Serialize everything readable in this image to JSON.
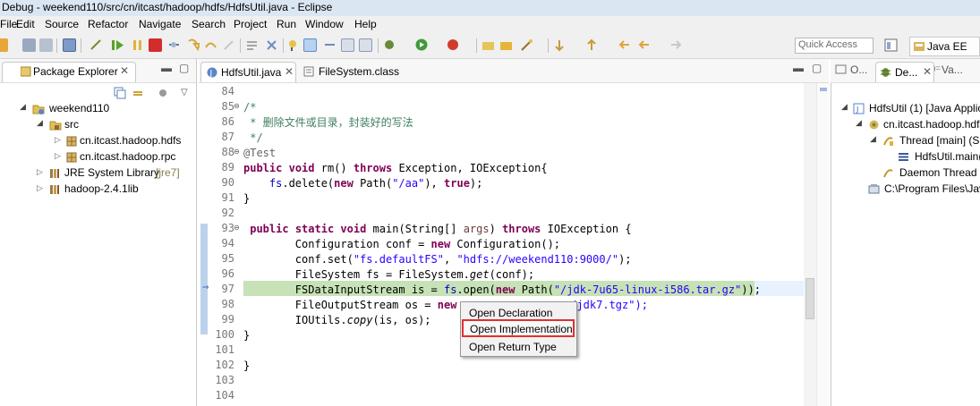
{
  "window": {
    "title": "Debug - weekend110/src/cn/itcast/hadoop/hdfs/HdfsUtil.java - Eclipse"
  },
  "menu": [
    "File",
    "Edit",
    "Source",
    "Refactor",
    "Navigate",
    "Search",
    "Project",
    "Run",
    "Window",
    "Help"
  ],
  "toolbar": {
    "quick_access_placeholder": "Quick Access",
    "perspective": "Java EE"
  },
  "package_explorer": {
    "title": "Package Explorer",
    "tree": [
      {
        "label": "weekend110",
        "icon": "project-icon"
      },
      {
        "label": "src",
        "icon": "source-folder-icon"
      },
      {
        "label": "cn.itcast.hadoop.hdfs",
        "icon": "package-icon"
      },
      {
        "label": "cn.itcast.hadoop.rpc",
        "icon": "package-icon"
      },
      {
        "label": "JRE System Library",
        "suffix": "[jre7]",
        "icon": "library-icon"
      },
      {
        "label": "hadoop-2.4.1lib",
        "icon": "library-icon"
      }
    ]
  },
  "editor": {
    "tabs": [
      {
        "label": "HdfsUtil.java",
        "active": true
      },
      {
        "label": "FileSystem.class",
        "active": false
      }
    ],
    "line_numbers": [
      "84",
      "85",
      "86",
      "87",
      "88",
      "89",
      "90",
      "91",
      "92",
      "93",
      "94",
      "95",
      "96",
      "97",
      "98",
      "99",
      "100",
      "101",
      "102",
      "103",
      "104"
    ],
    "lines": [
      "",
      "/*",
      " * 删除文件或目录，封装好的写法",
      " */",
      "@Test",
      "public void rm() throws Exception, IOException{",
      "    fs.delete(new Path(\"/aa\"), true);",
      "}",
      "",
      " public static void main(String[] args) throws IOException {",
      "        Configuration conf = new Configuration();",
      "        conf.set(\"fs.defaultFS\", \"hdfs://weekend110:9000/\");",
      "        FileSystem fs = FileSystem.get(conf);",
      "        FSDataInputStream is = fs.open(new Path(\"/jdk-7u65-linux-i586.tar.gz\"));",
      "        FileOutputStream os = new ",
      "        IOUtils.copy(is, os);",
      "}",
      "",
      "}",
      "",
      ""
    ],
    "line98_tail": ":/jdk7.tgz\");"
  },
  "context_menu": {
    "items": [
      "Open Declaration",
      "Open Implementation",
      "Open Return Type"
    ],
    "selected_index": 1
  },
  "debug_view": {
    "tabs": [
      "O...",
      "De...",
      "Va..."
    ],
    "tree": [
      "HdfsUtil (1) [Java Applic",
      "cn.itcast.hadoop.hdfs",
      "Thread [main] (Su",
      "HdfsUtil.main(",
      "Daemon Thread [",
      "C:\\Program Files\\Jav"
    ]
  },
  "colors": {
    "keyword": "#7f0055",
    "string": "#2a00ff",
    "comment": "#3f7f5f",
    "field": "#0000c0",
    "debug_line": "#c6e2b6",
    "highlight_box": "#e03030"
  }
}
